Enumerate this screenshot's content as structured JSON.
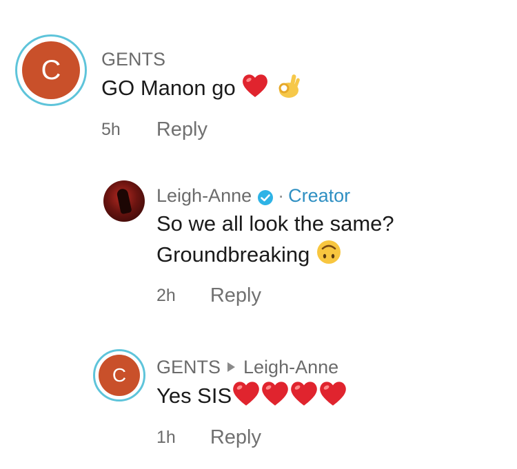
{
  "comments": [
    {
      "avatar_letter": "C",
      "username": "GENTS",
      "text": "GO Manon go",
      "emojis": [
        "heart-icon",
        "ok-hand-icon"
      ],
      "time": "5h",
      "reply_label": "Reply"
    },
    {
      "username": "Leigh-Anne",
      "verified": true,
      "separator": "·",
      "badge": "Creator",
      "text_line1": "So we all look the same?",
      "text_line2": "Groundbreaking",
      "emojis": [
        "upside-down-face-icon"
      ],
      "time": "2h",
      "reply_label": "Reply"
    },
    {
      "avatar_letter": "C",
      "username": "GENTS",
      "reply_to": "Leigh-Anne",
      "text": "Yes SIS",
      "emojis": [
        "heart-icon",
        "heart-icon",
        "heart-icon",
        "heart-icon"
      ],
      "time": "1h",
      "reply_label": "Reply"
    }
  ],
  "colors": {
    "avatar_bg": "#c9502a",
    "avatar_ring": "#5ec4da",
    "creator_badge": "#2e8fc2",
    "verified": "#2eb3e6",
    "heart": "#e0242e"
  }
}
